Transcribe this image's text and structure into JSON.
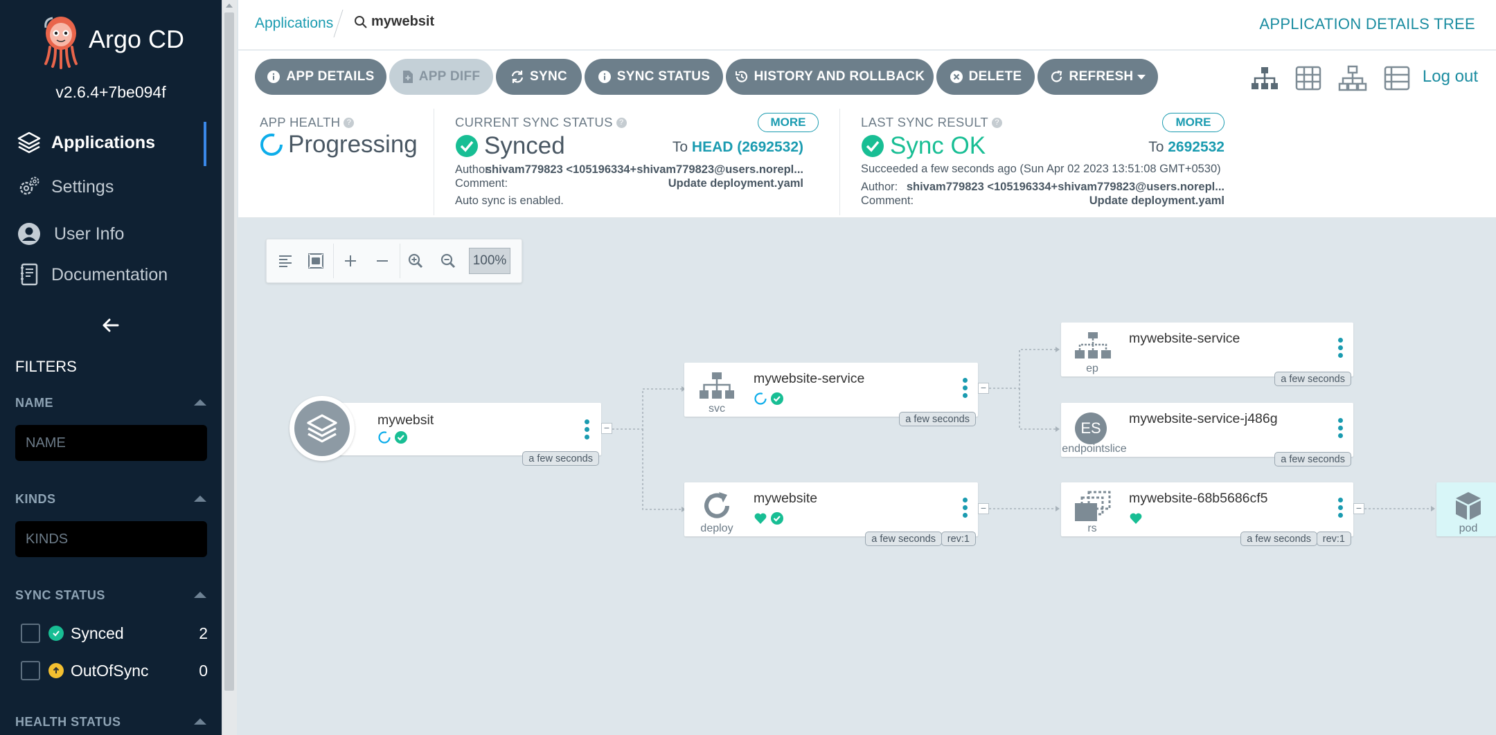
{
  "sidebar": {
    "brand": "Argo CD",
    "version": "v2.6.4+7be094f",
    "nav": [
      {
        "label": "Applications"
      },
      {
        "label": "Settings"
      },
      {
        "label": "User Info"
      },
      {
        "label": "Documentation"
      }
    ],
    "filters_title": "FILTERS",
    "name_filter": {
      "label": "NAME",
      "placeholder": "NAME"
    },
    "kinds_filter": {
      "label": "KINDS",
      "placeholder": "KINDS"
    },
    "sync_status": {
      "label": "SYNC STATUS",
      "items": [
        {
          "label": "Synced",
          "count": "2"
        },
        {
          "label": "OutOfSync",
          "count": "0"
        }
      ]
    },
    "health_status": {
      "label": "HEALTH STATUS"
    }
  },
  "header": {
    "breadcrumb": "Applications",
    "search_value": "mywebsit",
    "title": "APPLICATION DETAILS TREE"
  },
  "toolbar": {
    "buttons": [
      "APP DETAILS",
      "APP DIFF",
      "SYNC",
      "SYNC STATUS",
      "HISTORY AND ROLLBACK",
      "DELETE",
      "REFRESH"
    ],
    "logout": "Log out"
  },
  "app_health": {
    "title": "APP HEALTH",
    "status": "Progressing"
  },
  "current_sync": {
    "title": "CURRENT SYNC STATUS",
    "status": "Synced",
    "more": "MORE",
    "to_prefix": "To",
    "revision": "HEAD (2692532)",
    "author_label": "Author:",
    "author": "shivam779823 <105196334+shivam779823@users.norepl...",
    "comment_label": "Comment:",
    "comment": "Update deployment.yaml",
    "auto_sync": "Auto sync is enabled."
  },
  "last_sync": {
    "title": "LAST SYNC RESULT",
    "status": "Sync OK",
    "more": "MORE",
    "to_prefix": "To",
    "revision": "2692532",
    "succeeded": "Succeeded a few seconds ago (Sun Apr 02 2023 13:51:08 GMT+0530)",
    "author_label": "Author:",
    "author": "shivam779823 <105196334+shivam779823@users.norepl...",
    "comment_label": "Comment:",
    "comment": "Update deployment.yaml"
  },
  "graph": {
    "zoom": "100%",
    "nodes": {
      "app": {
        "name": "mywebsit",
        "age": "a few seconds"
      },
      "svc": {
        "name": "mywebsite-service",
        "kind": "svc",
        "age": "a few seconds"
      },
      "ep": {
        "name": "mywebsite-service",
        "kind": "ep",
        "age": "a few seconds"
      },
      "es": {
        "name": "mywebsite-service-j486g",
        "kind": "endpointslice",
        "icon_text": "ES",
        "age": "a few seconds"
      },
      "deploy": {
        "name": "mywebsite",
        "kind": "deploy",
        "age": "a few seconds",
        "rev": "rev:1"
      },
      "rs": {
        "name": "mywebsite-68b5686cf5",
        "kind": "rs",
        "age": "a few seconds",
        "rev": "rev:1"
      },
      "pod": {
        "kind": "pod"
      }
    }
  },
  "colors": {
    "sidebar_bg": "#0f2133",
    "accent": "#1a9bb0",
    "synced_green": "#18be94",
    "progressing_blue": "#0dadea",
    "outofsync_yellow": "#f4c030",
    "button_grey": "#6d7f8b"
  }
}
